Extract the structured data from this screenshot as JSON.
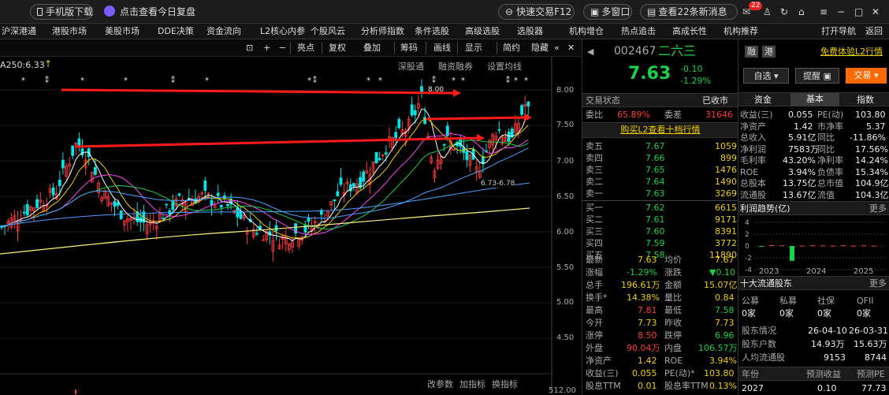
{
  "topbar": {
    "mobile_download": "手机版下载",
    "review_link": "点击查看今日复盘",
    "quick_trade": "快速交易F12",
    "multi_window": "多窗口",
    "news": "查看22条新消息",
    "mail_badge": "22"
  },
  "nav": [
    "沪深港通",
    "港股市场",
    "美股市场",
    "DDE决策",
    "资金流向",
    "L2核心内参",
    "个股风云",
    "分析师指数",
    "条件选股",
    "高级选股",
    "选股器",
    "机构增仓",
    "热点追击",
    "高成长性",
    "机构推荐",
    "打开导航",
    "返回"
  ],
  "toolbar": {
    "plus": "+",
    "minus": "−",
    "highlight": "亮点",
    "restore": "复权",
    "overlay": "叠加",
    "chips": "筹码",
    "draw": "画线",
    "display": "显示",
    "simple": "简约",
    "hide": "隐藏"
  },
  "chart_sub": {
    "shsz": "深股通",
    "margin": "融资融券",
    "set_ma": "设置均线"
  },
  "chart_data": {
    "type": "candlestick",
    "ma_label": "A250:6.33",
    "yaxis": [
      "8.00",
      "7.50",
      "7.00",
      "6.50",
      "6.00",
      "5.50",
      "5.00",
      "4.50"
    ],
    "high_label": "8.00",
    "low_label": "6.73-6.78",
    "volume_label": "512.00",
    "bottom_tabs": [
      "改参数",
      "加指标",
      "换指标"
    ]
  },
  "quote": {
    "code": "002467",
    "name": "二六三",
    "rong": "融",
    "gang": "港",
    "free_l2": "免费体验L2行情",
    "price": "7.63",
    "chg": "-0.10",
    "pct": "-1.29%",
    "fav": "自选",
    "remind": "提醒",
    "trade": "交易"
  },
  "status": {
    "label": "交易状态",
    "value": "已收市",
    "wb_label": "委比",
    "wb": "65.89%",
    "wc_label": "委差",
    "wc": "31646",
    "buy_l2": "购买L2查看十档行情"
  },
  "asks": [
    {
      "l": "卖五",
      "p": "7.67",
      "v": "1059"
    },
    {
      "l": "卖四",
      "p": "7.66",
      "v": "899"
    },
    {
      "l": "卖三",
      "p": "7.65",
      "v": "1476"
    },
    {
      "l": "卖二",
      "p": "7.64",
      "v": "1490"
    },
    {
      "l": "卖一",
      "p": "7.63",
      "v": "3269"
    }
  ],
  "bids": [
    {
      "l": "买一",
      "p": "7.62",
      "v": "6615"
    },
    {
      "l": "买二",
      "p": "7.61",
      "v": "9171"
    },
    {
      "l": "买三",
      "p": "7.60",
      "v": "8391"
    },
    {
      "l": "买四",
      "p": "7.59",
      "v": "3772"
    },
    {
      "l": "买五",
      "p": "7.58",
      "v": "11890"
    }
  ],
  "stats": [
    [
      "最新",
      "7.63",
      "均价",
      "7.67"
    ],
    [
      "涨幅",
      "-1.29%",
      "涨跌",
      "▼0.10"
    ],
    [
      "总手",
      "196.61万",
      "金额",
      "15.07亿"
    ],
    [
      "换手*",
      "14.38%",
      "量比",
      "0.84"
    ],
    [
      "最高",
      "7.81",
      "最低",
      "7.58"
    ],
    [
      "今开",
      "7.73",
      "昨收",
      "7.73"
    ],
    [
      "涨停",
      "8.50",
      "跌停",
      "6.96"
    ],
    [
      "外盘",
      "90.04万",
      "内盘",
      "106.57万"
    ],
    [
      "净资产",
      "1.42",
      "ROE",
      "3.94%"
    ],
    [
      "收益(三)",
      "0.055",
      "PE(动)*",
      "103.80"
    ],
    [
      "股息TTM",
      "0.01",
      "股息率TTM",
      "0.13%"
    ]
  ],
  "far_tabs": [
    "资金",
    "基本",
    "指数"
  ],
  "fund": [
    [
      "收益(三)",
      "0.055",
      "PE(动)",
      "103.80"
    ],
    [
      "净资产",
      "1.42",
      "市净率",
      "5.37"
    ],
    [
      "总收入",
      "5.91亿",
      "同比",
      "-11.86%"
    ],
    [
      "净利润",
      "7583万",
      "同比",
      "17.56%"
    ],
    [
      "毛利率",
      "43.20%",
      "净利率",
      "14.24%"
    ],
    [
      "ROE",
      "3.94%",
      "负债率",
      "15.34%"
    ],
    [
      "总股本",
      "13.75亿",
      "总市值",
      "104.9亿"
    ],
    [
      "流通股",
      "13.67亿",
      "流值",
      "104.3亿"
    ]
  ],
  "profit": {
    "title": "利润趋势(亿)",
    "more": "更多",
    "yaxis": [
      "4",
      "2",
      "0",
      "-2",
      "-4"
    ],
    "years": [
      "2023",
      "2024",
      "2025"
    ],
    "bars": [
      -0.1,
      0.15,
      0.1,
      -2.5,
      0.05,
      0.1,
      0.1,
      0.05,
      0.1,
      0.05,
      0.1,
      0.05
    ]
  },
  "holders": {
    "title": "十大流通股东",
    "more": "更多",
    "cats": [
      "公募",
      "私募",
      "社保",
      "QFII"
    ],
    "vals": [
      "0家",
      "0家",
      "0家",
      "0家"
    ],
    "info_label": "股东情况",
    "d1": "26-04-10",
    "d2": "26-03-31",
    "num_label": "股东户数",
    "n1": "14.93万",
    "n2": "15.63万",
    "avg_label": "人均流通股",
    "a1": "9153",
    "a2": "8744"
  },
  "forecast": {
    "year_label": "年份",
    "eps_label": "预测收益",
    "pe_label": "预测PE",
    "year": "2027",
    "eps": "0.10",
    "pe": "77.73"
  }
}
